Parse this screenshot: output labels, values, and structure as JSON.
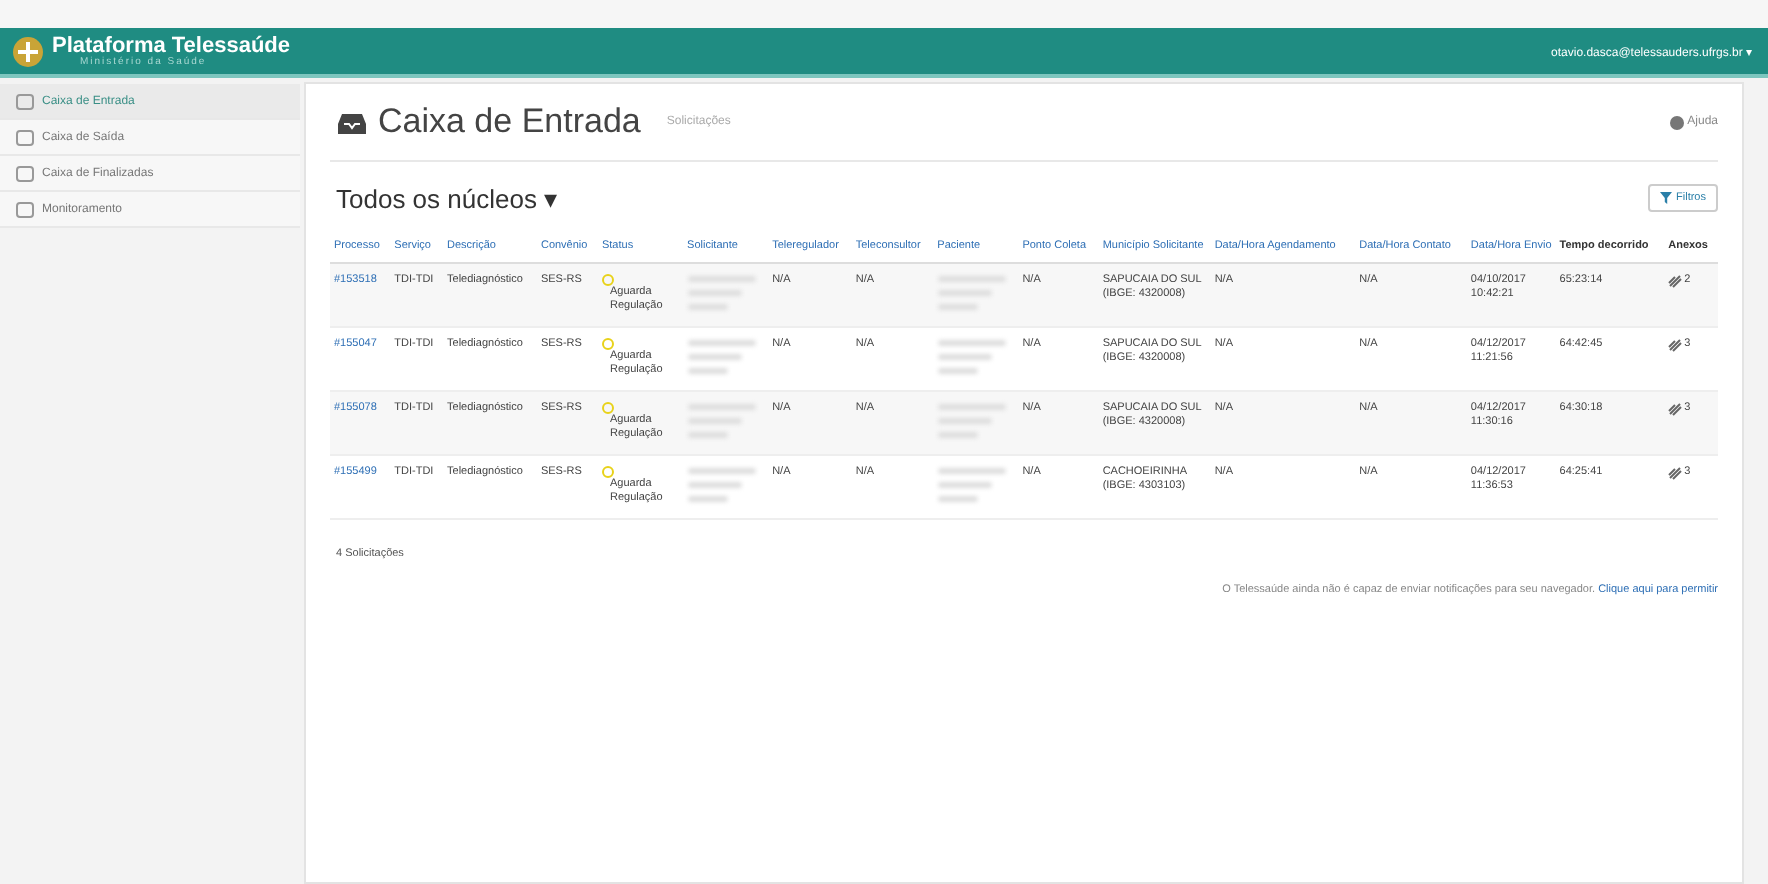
{
  "brand": {
    "title": "Plataforma Telessaúde",
    "subtitle": "Ministério da Saúde"
  },
  "user": {
    "email": "otavio.dasca@telessauders.ufrgs.br ▾"
  },
  "sidebar": {
    "items": [
      {
        "label": "Caixa de Entrada",
        "selected": true
      },
      {
        "label": "Caixa de Saída",
        "selected": false
      },
      {
        "label": "Caixa de Finalizadas",
        "selected": false
      },
      {
        "label": "Monitoramento",
        "selected": false
      }
    ]
  },
  "page": {
    "title": "Caixa de Entrada",
    "subtitle": "Solicitações",
    "help": "Ajuda"
  },
  "section": {
    "title": "Todos os núcleos ▾",
    "filter": "Filtros"
  },
  "table": {
    "columns": [
      {
        "label": "Processo",
        "link": true
      },
      {
        "label": "Serviço",
        "link": true
      },
      {
        "label": "Descrição",
        "link": true
      },
      {
        "label": "Convênio",
        "link": true
      },
      {
        "label": "Status",
        "link": true
      },
      {
        "label": "Solicitante",
        "link": true
      },
      {
        "label": "Teleregulador",
        "link": true
      },
      {
        "label": "Teleconsultor",
        "link": true
      },
      {
        "label": "Paciente",
        "link": true
      },
      {
        "label": "Ponto Coleta",
        "link": true
      },
      {
        "label": "Município Solicitante",
        "link": true
      },
      {
        "label": "Data/Hora Agendamento",
        "link": true
      },
      {
        "label": "Data/Hora Contato",
        "link": true
      },
      {
        "label": "Data/Hora Envio",
        "link": true
      },
      {
        "label": "Tempo decorrido",
        "link": false
      },
      {
        "label": "Anexos",
        "link": false
      }
    ],
    "rows": [
      {
        "processo": "#153518",
        "servico": "TDI-TDI",
        "descricao": "Telediagnóstico",
        "convenio": "SES-RS",
        "status": {
          "label": "Aguarda Regulação",
          "color": "#e8d21a"
        },
        "teleregulador": "N/A",
        "teleconsultor": "N/A",
        "ponto_coleta": "N/A",
        "municipio": "SAPUCAIA DO SUL (IBGE: 4320008)",
        "agendamento": "N/A",
        "contato": "N/A",
        "envio": "04/10/2017 10:42:21",
        "tempo": "65:23:14",
        "anexos": "2"
      },
      {
        "processo": "#155047",
        "servico": "TDI-TDI",
        "descricao": "Telediagnóstico",
        "convenio": "SES-RS",
        "status": {
          "label": "Aguarda Regulação",
          "color": "#e8d21a"
        },
        "teleregulador": "N/A",
        "teleconsultor": "N/A",
        "ponto_coleta": "N/A",
        "municipio": "SAPUCAIA DO SUL (IBGE: 4320008)",
        "agendamento": "N/A",
        "contato": "N/A",
        "envio": "04/12/2017 11:21:56",
        "tempo": "64:42:45",
        "anexos": "3"
      },
      {
        "processo": "#155078",
        "servico": "TDI-TDI",
        "descricao": "Telediagnóstico",
        "convenio": "SES-RS",
        "status": {
          "label": "Aguarda Regulação",
          "color": "#e8d21a"
        },
        "teleregulador": "N/A",
        "teleconsultor": "N/A",
        "ponto_coleta": "N/A",
        "municipio": "SAPUCAIA DO SUL (IBGE: 4320008)",
        "agendamento": "N/A",
        "contato": "N/A",
        "envio": "04/12/2017 11:30:16",
        "tempo": "64:30:18",
        "anexos": "3"
      },
      {
        "processo": "#155499",
        "servico": "TDI-TDI",
        "descricao": "Telediagnóstico",
        "convenio": "SES-RS",
        "status": {
          "label": "Aguarda Regulação",
          "color": "#e8d21a"
        },
        "teleregulador": "N/A",
        "teleconsultor": "N/A",
        "ponto_coleta": "N/A",
        "municipio": "CACHOEIRINHA (IBGE: 4303103)",
        "agendamento": "N/A",
        "contato": "N/A",
        "envio": "04/12/2017 11:36:53",
        "tempo": "64:25:41",
        "anexos": "3"
      }
    ]
  },
  "count": "4 Solicitações",
  "notice": {
    "text": "O Telessaúde ainda não é capaz de enviar notificações para seu navegador.",
    "link": "Clique aqui para permitir"
  }
}
